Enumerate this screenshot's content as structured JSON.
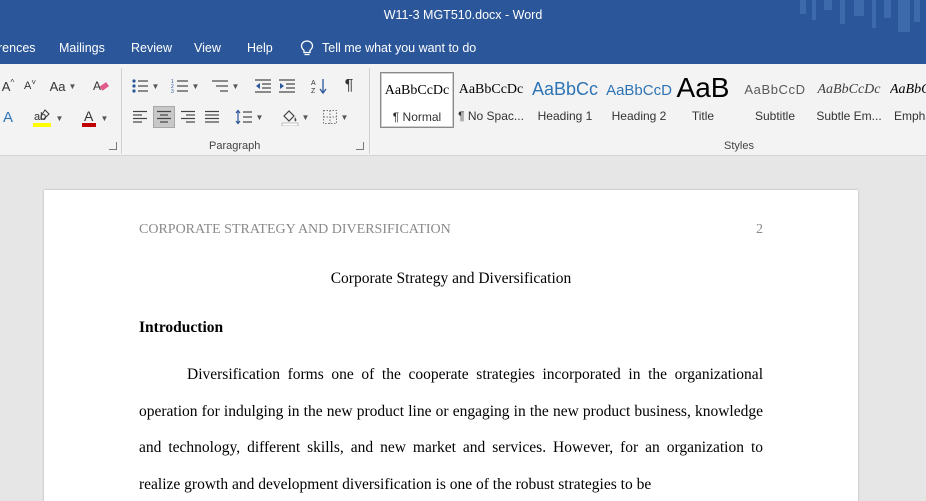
{
  "window": {
    "title": "W11-3 MGT510.docx  -  Word"
  },
  "menu": {
    "tabs": [
      "rences",
      "Mailings",
      "Review",
      "View",
      "Help"
    ],
    "tell_me": "Tell me what you want to do"
  },
  "ribbon": {
    "font_group": {
      "change_case_label": "Aa"
    },
    "paragraph_label": "Paragraph",
    "styles_label": "Styles",
    "styles": [
      {
        "sample": "AaBbCcDc",
        "name": "¶ Normal",
        "selected": true
      },
      {
        "sample": "AaBbCcDc",
        "name": "¶ No Spac...",
        "selected": false
      },
      {
        "sample": "AaBbCc",
        "name": "Heading 1",
        "selected": false
      },
      {
        "sample": "AaBbCcD",
        "name": "Heading 2",
        "selected": false
      },
      {
        "sample": "AaB",
        "name": "Title",
        "selected": false
      },
      {
        "sample": "AaBbCcD",
        "name": "Subtitle",
        "selected": false
      },
      {
        "sample": "AaBbCcDc",
        "name": "Subtle Em...",
        "selected": false
      },
      {
        "sample": "AaBbCc",
        "name": "Empha",
        "selected": false
      }
    ]
  },
  "document": {
    "header_text": "CORPORATE STRATEGY AND DIVERSIFICATION",
    "page_number": "2",
    "title": "Corporate Strategy and Diversification",
    "heading": "Introduction",
    "paragraph": "Diversification forms one of the cooperate strategies incorporated in the organizational operation for indulging in the new product line or engaging in the new product business, knowledge and technology, different skills, and new market and services. However, for an organization to realize growth and development diversification is one of the robust strategies to be"
  },
  "colors": {
    "title_bar": "#2b579a",
    "ribbon_bg": "#f3f3f3",
    "doc_bg": "#e6e6e6",
    "heading_blue": "#2e74b5",
    "highlight_yellow": "#ffff00",
    "font_color_red": "#c00000"
  }
}
